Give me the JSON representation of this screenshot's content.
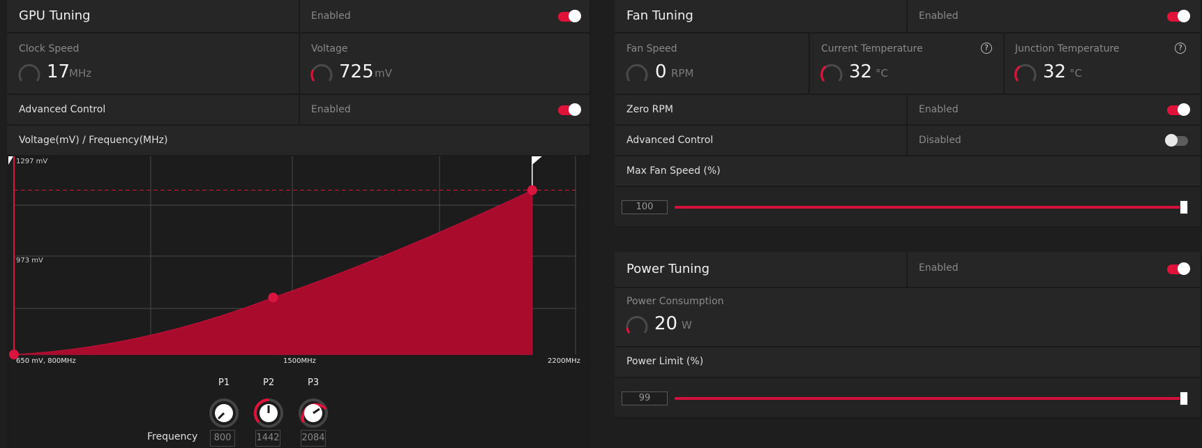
{
  "gpu": {
    "title": "GPU Tuning",
    "status": "Enabled",
    "clock": {
      "label": "Clock Speed",
      "value": "17",
      "unit": "MHz"
    },
    "voltage": {
      "label": "Voltage",
      "value": "725",
      "unit": "mV"
    },
    "advanced": {
      "label": "Advanced Control",
      "status": "Enabled"
    },
    "curve_title": "Voltage(mV) / Frequency(MHz)",
    "p_labels": [
      "P1",
      "P2",
      "P3"
    ],
    "frequency_label": "Frequency",
    "frequencies": [
      "800",
      "1442",
      "2084"
    ]
  },
  "chart_data": {
    "type": "area",
    "y_tick_labels": [
      "1297 mV",
      "973 mV"
    ],
    "x_tick_labels": [
      "650 mV, 800MHz",
      "1500MHz",
      "2200MHz"
    ],
    "points": [
      {
        "x": 800,
        "y": 650
      },
      {
        "x": 1442,
        "y": 840
      },
      {
        "x": 2084,
        "y": 1198
      }
    ],
    "xlim": [
      800,
      2200
    ],
    "ylim": [
      650,
      1297
    ],
    "grid": true,
    "colors": {
      "fill": "#a80b2c",
      "line": "#d9143e"
    }
  },
  "fan": {
    "title": "Fan Tuning",
    "status": "Enabled",
    "speed": {
      "label": "Fan Speed",
      "value": "0",
      "unit": "RPM"
    },
    "current_temp": {
      "label": "Current Temperature",
      "value": "32",
      "unit": "°C"
    },
    "junction_temp": {
      "label": "Junction Temperature",
      "value": "32",
      "unit": "°C"
    },
    "zero_rpm": {
      "label": "Zero RPM",
      "status": "Enabled"
    },
    "advanced": {
      "label": "Advanced Control",
      "status": "Disabled"
    },
    "max_speed": {
      "label": "Max Fan Speed (%)",
      "value": "100"
    }
  },
  "power": {
    "title": "Power Tuning",
    "status": "Enabled",
    "consumption": {
      "label": "Power Consumption",
      "value": "20",
      "unit": "W"
    },
    "limit": {
      "label": "Power Limit (%)",
      "value": "99"
    }
  },
  "colors": {
    "accent": "#e0123a",
    "panel": "#262627",
    "background": "#1e1e1f"
  }
}
